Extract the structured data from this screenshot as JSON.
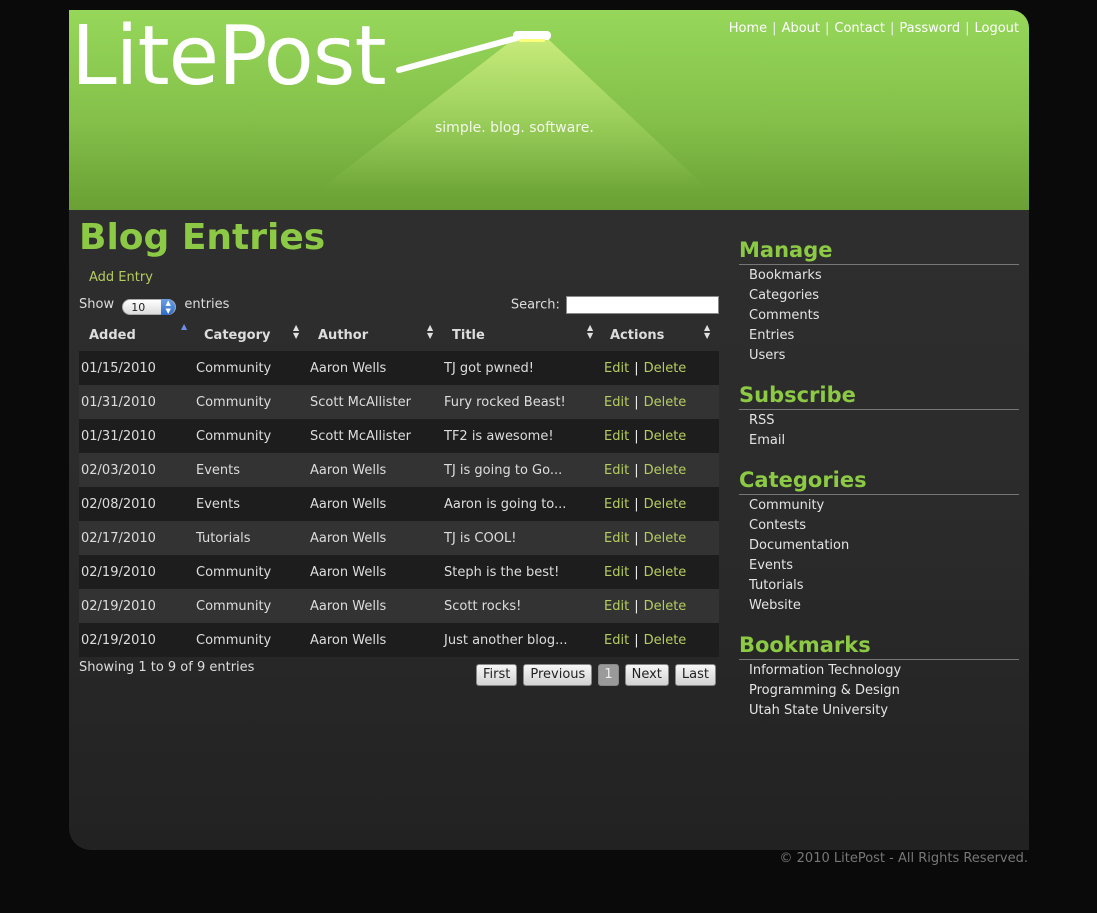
{
  "header": {
    "logo": "LitePost",
    "tagline": "simple. blog. software.",
    "nav": [
      "Home",
      "About",
      "Contact",
      "Password",
      "Logout"
    ]
  },
  "main": {
    "title": "Blog Entries",
    "add_entry": "Add Entry",
    "length": {
      "prefix": "Show",
      "value": "10",
      "suffix": "entries"
    },
    "search_label": "Search:",
    "search_value": "",
    "columns": [
      "Added",
      "Category",
      "Author",
      "Title",
      "Actions"
    ],
    "rows": [
      {
        "added": "01/15/2010",
        "category": "Community",
        "author": "Aaron Wells",
        "title": "TJ got pwned!"
      },
      {
        "added": "01/31/2010",
        "category": "Community",
        "author": "Scott McAllister",
        "title": "Fury rocked Beast!"
      },
      {
        "added": "01/31/2010",
        "category": "Community",
        "author": "Scott McAllister",
        "title": "TF2 is awesome!"
      },
      {
        "added": "02/03/2010",
        "category": "Events",
        "author": "Aaron Wells",
        "title": "TJ is going to Go..."
      },
      {
        "added": "02/08/2010",
        "category": "Events",
        "author": "Aaron Wells",
        "title": "Aaron is going to..."
      },
      {
        "added": "02/17/2010",
        "category": "Tutorials",
        "author": "Aaron Wells",
        "title": "TJ is COOL!"
      },
      {
        "added": "02/19/2010",
        "category": "Community",
        "author": "Aaron Wells",
        "title": "Steph is the best!"
      },
      {
        "added": "02/19/2010",
        "category": "Community",
        "author": "Aaron Wells",
        "title": "Scott rocks!"
      },
      {
        "added": "02/19/2010",
        "category": "Community",
        "author": "Aaron Wells",
        "title": "Just another blog..."
      }
    ],
    "action_edit": "Edit",
    "action_sep": "|",
    "action_delete": "Delete",
    "info": "Showing 1 to 9 of 9 entries",
    "pager": {
      "first": "First",
      "previous": "Previous",
      "current": "1",
      "next": "Next",
      "last": "Last"
    }
  },
  "sidebar": {
    "manage": {
      "title": "Manage",
      "items": [
        "Bookmarks",
        "Categories",
        "Comments",
        "Entries",
        "Users"
      ]
    },
    "subscribe": {
      "title": "Subscribe",
      "items": [
        "RSS",
        "Email"
      ]
    },
    "categories": {
      "title": "Categories",
      "items": [
        "Community",
        "Contests",
        "Documentation",
        "Events",
        "Tutorials",
        "Website"
      ]
    },
    "bookmarks": {
      "title": "Bookmarks",
      "items": [
        "Information Technology",
        "Programming & Design",
        "Utah State University"
      ]
    }
  },
  "footer": "© 2010 LitePost - All Rights Reserved.",
  "colors": {
    "accent": "#8cc944",
    "link": "#b4cd60",
    "header_top": "#96d75a",
    "header_bottom": "#6aa034"
  }
}
